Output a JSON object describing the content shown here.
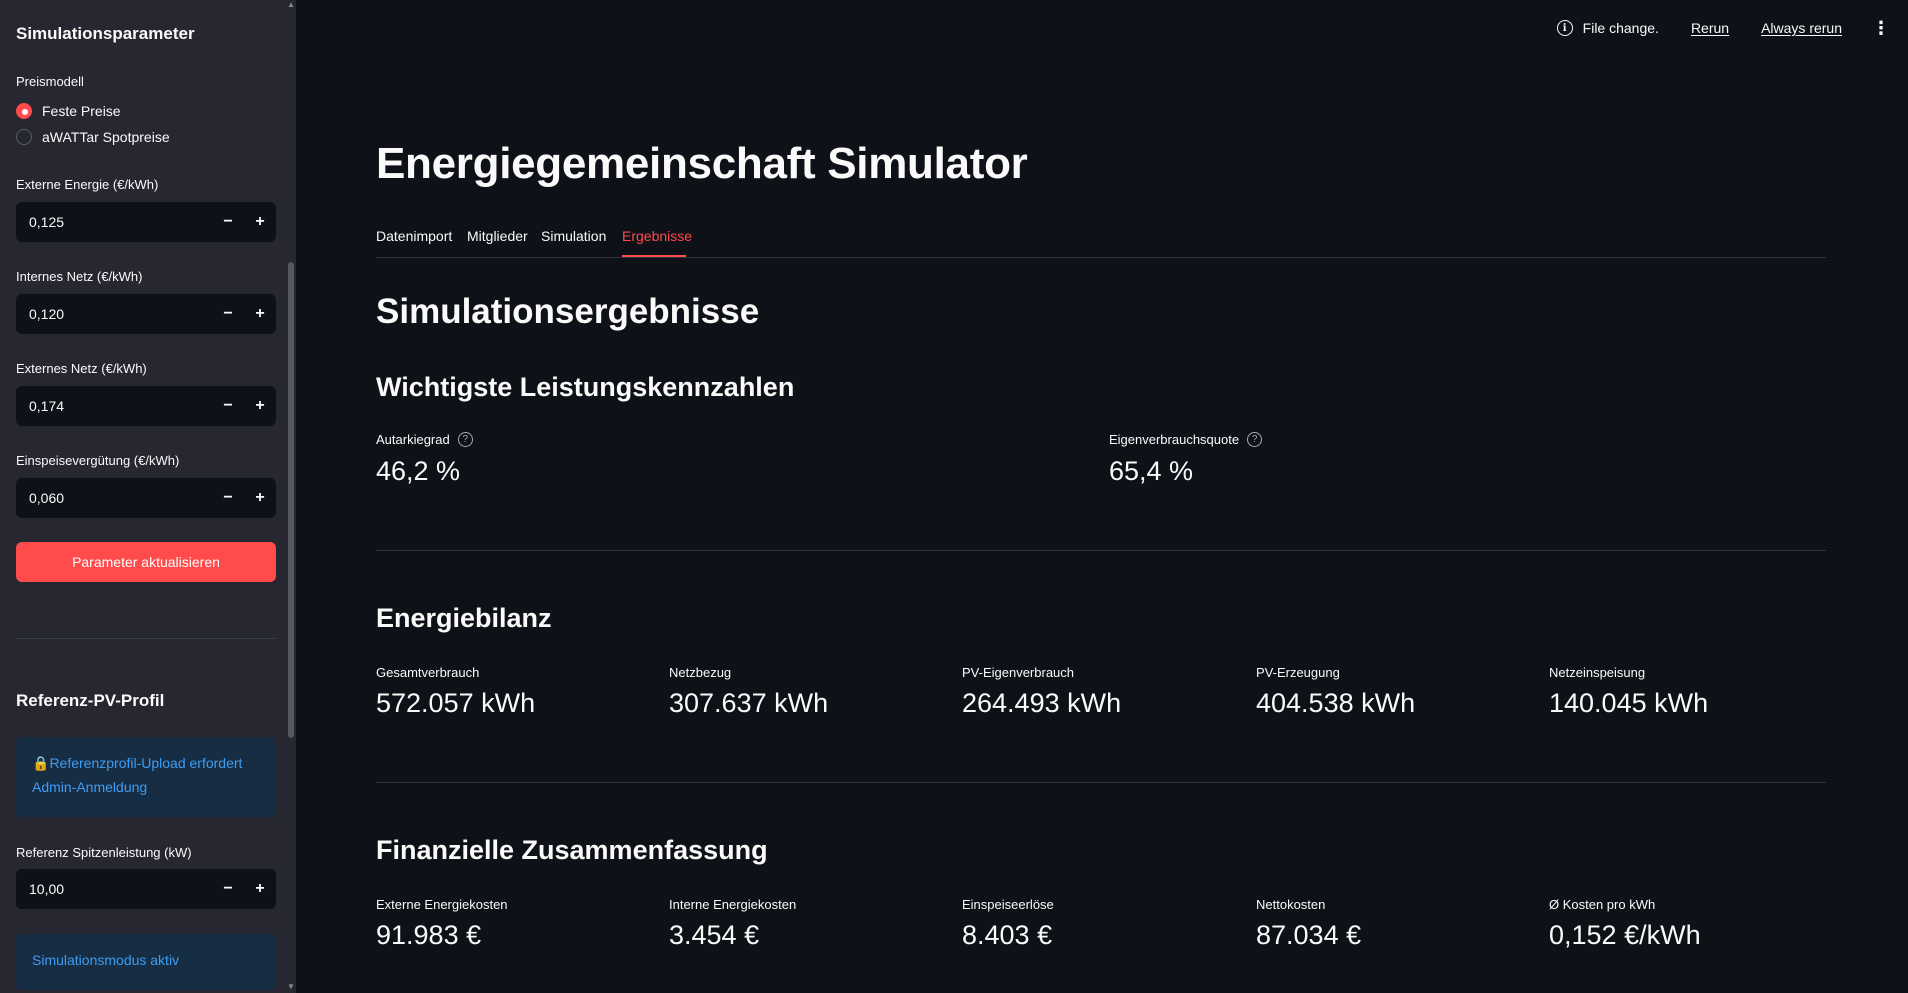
{
  "sidebar": {
    "title": "Simulationsparameter",
    "price_model": {
      "label": "Preismodell",
      "options": [
        "Feste Preise",
        "aWATTar Spotpreise"
      ],
      "selected": "Feste Preise"
    },
    "inputs": [
      {
        "label": "Externe Energie (€/kWh)",
        "value": "0,125"
      },
      {
        "label": "Internes Netz (€/kWh)",
        "value": "0,120"
      },
      {
        "label": "Externes Netz (€/kWh)",
        "value": "0,174"
      },
      {
        "label": "Einspeisevergütung (€/kWh)",
        "value": "0,060"
      }
    ],
    "update_button": "Parameter aktualisieren",
    "reference_title": "Referenz-PV-Profil",
    "reference_info": "Referenzprofil-Upload erfordert Admin-Anmeldung",
    "peak_input": {
      "label": "Referenz Spitzenleistung (kW)",
      "value": "10,00"
    },
    "sim_mode_info": "Simulationsmodus aktiv",
    "step_minus": "−",
    "step_plus": "+"
  },
  "header": {
    "file_change": "File change.",
    "rerun": "Rerun",
    "always_rerun": "Always rerun"
  },
  "main": {
    "title": "Energiegemeinschaft Simulator",
    "tabs": [
      "Datenimport",
      "Mitglieder",
      "Simulation",
      "Ergebnisse"
    ],
    "active_tab": "Ergebnisse",
    "results_heading": "Simulationsergebnisse",
    "kpi": {
      "heading": "Wichtigste Leistungskennzahlen",
      "metrics": [
        {
          "label": "Autarkiegrad",
          "value": "46,2 %"
        },
        {
          "label": "Eigenverbrauchsquote",
          "value": "65,4 %"
        }
      ]
    },
    "energy": {
      "heading": "Energiebilanz",
      "metrics": [
        {
          "label": "Gesamtverbrauch",
          "value": "572.057 kWh"
        },
        {
          "label": "Netzbezug",
          "value": "307.637 kWh"
        },
        {
          "label": "PV-Eigenverbrauch",
          "value": "264.493 kWh"
        },
        {
          "label": "PV-Erzeugung",
          "value": "404.538 kWh"
        },
        {
          "label": "Netzeinspeisung",
          "value": "140.045 kWh"
        }
      ]
    },
    "finance": {
      "heading": "Finanzielle Zusammenfassung",
      "metrics": [
        {
          "label": "Externe Energiekosten",
          "value": "91.983 €"
        },
        {
          "label": "Interne Energiekosten",
          "value": "3.454 €"
        },
        {
          "label": "Einspeiseerlöse",
          "value": "8.403 €"
        },
        {
          "label": "Nettokosten",
          "value": "87.034 €"
        },
        {
          "label": "Ø Kosten pro kWh",
          "value": "0,152 €/kWh"
        }
      ]
    }
  },
  "colors": {
    "accent": "#ff4b4b",
    "background": "#0e1117",
    "sidebar": "#262730",
    "info_bg": "#172d43",
    "info_text": "#3d9df3"
  }
}
